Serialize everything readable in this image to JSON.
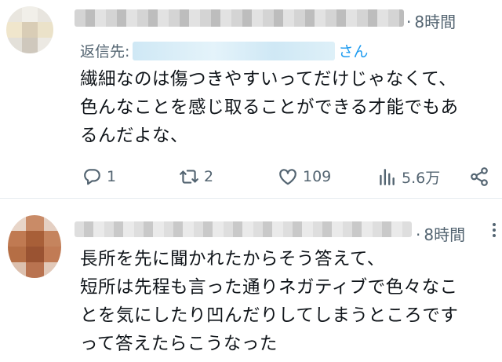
{
  "tweets": [
    {
      "timestamp": "8時間",
      "reply_prefix": "返信先:",
      "reply_suffix": "さん",
      "body": "繊細なのは傷つきやすいってだけじゃなくて、\n色んなことを感じ取ることができる才能でもあ\nるんだよな、",
      "reply_count": "1",
      "retweet_count": "2",
      "like_count": "109",
      "view_count": "5.6万"
    },
    {
      "timestamp": "8時間",
      "body": "長所を先に聞かれたからそう答えて、\n短所は先程も言った通りネガティブで色々なこ\nとを気にしたり凹んだりしてしまうところです\nって答えたらこうなった"
    }
  ],
  "icons": {
    "reply": "reply-icon",
    "retweet": "retweet-icon",
    "like": "heart-icon",
    "views": "views-icon",
    "share": "share-icon",
    "more": "more-icon"
  },
  "colors": {
    "text": "#0f1419",
    "muted": "#536471",
    "link": "#1d9bf0"
  }
}
